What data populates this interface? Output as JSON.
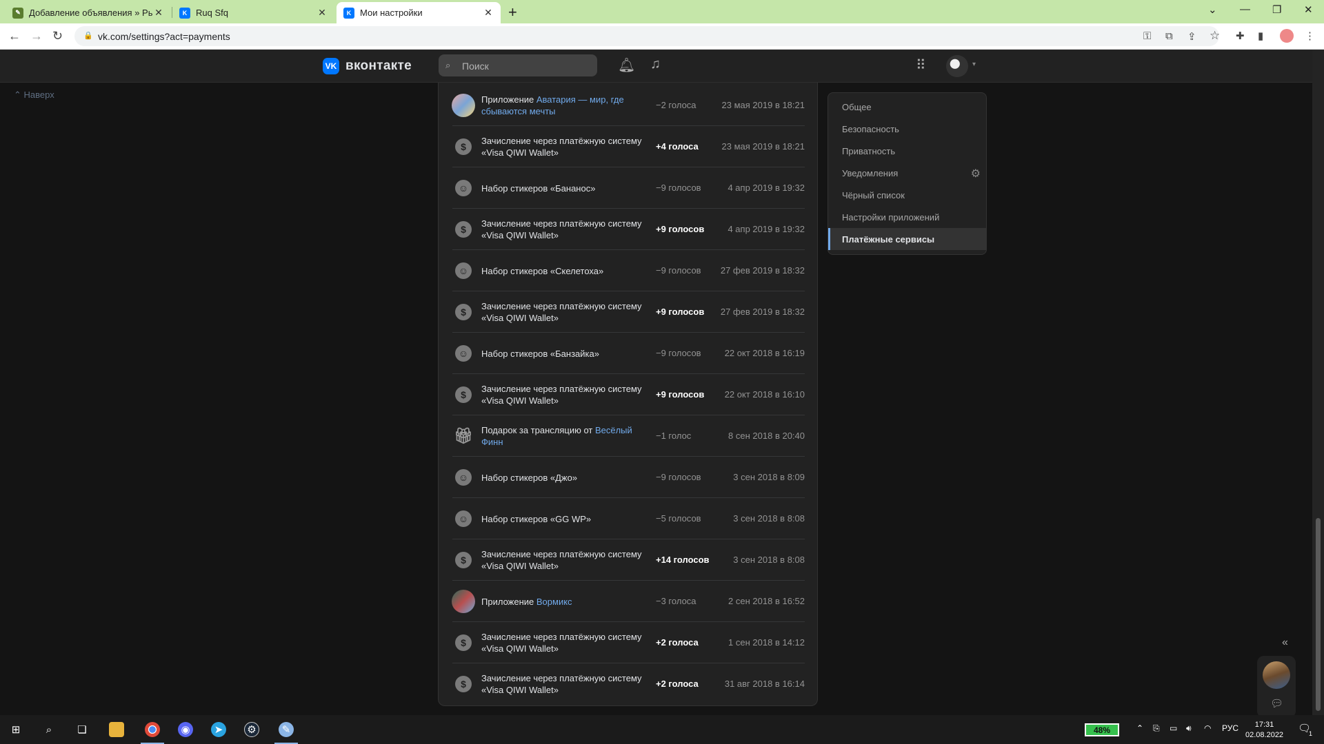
{
  "browser": {
    "tabs": [
      {
        "title": "Добавление объявления » Рын",
        "icon": "feather-icon",
        "color": "#5a7d2e",
        "active": false
      },
      {
        "title": "Ruq Sfq",
        "icon": "vk-icon",
        "color": "#0077ff",
        "active": false
      },
      {
        "title": "Мои настройки",
        "icon": "vk-icon",
        "color": "#0077ff",
        "active": true
      }
    ],
    "new_tab": "+",
    "address": "vk.com/settings?act=payments"
  },
  "vk": {
    "logo_text": "вконтакте",
    "logo_mark": "VK",
    "search_placeholder": "Поиск",
    "scroll_up_label": "Наверх",
    "accent": "#0077ff",
    "link_color": "#71aaeb"
  },
  "transactions": [
    {
      "kind": "app",
      "icon": "app-avatar-icon",
      "text": "Приложение ",
      "link": "Аватария — мир, где сбываются мечты",
      "amount": "−2 голоса",
      "positive": false,
      "date": "23 мая 2019 в 18:21"
    },
    {
      "kind": "pay",
      "icon": "dollar-icon",
      "text": "Зачисление через платёжную систему «Visa QIWI Wallet»",
      "link": "",
      "amount": "+4 голоса",
      "positive": true,
      "date": "23 мая 2019 в 18:21"
    },
    {
      "kind": "sticker",
      "icon": "smile-icon",
      "text": "Набор стикеров «Бананос»",
      "link": "",
      "amount": "−9 голосов",
      "positive": false,
      "date": "4 апр 2019 в 19:32"
    },
    {
      "kind": "pay",
      "icon": "dollar-icon",
      "text": "Зачисление через платёжную систему «Visa QIWI Wallet»",
      "link": "",
      "amount": "+9 голосов",
      "positive": true,
      "date": "4 апр 2019 в 19:32"
    },
    {
      "kind": "sticker",
      "icon": "smile-icon",
      "text": "Набор стикеров «Скелетоха»",
      "link": "",
      "amount": "−9 голосов",
      "positive": false,
      "date": "27 фев 2019 в 18:32"
    },
    {
      "kind": "pay",
      "icon": "dollar-icon",
      "text": "Зачисление через платёжную систему «Visa QIWI Wallet»",
      "link": "",
      "amount": "+9 голосов",
      "positive": true,
      "date": "27 фев 2019 в 18:32"
    },
    {
      "kind": "sticker",
      "icon": "smile-icon",
      "text": "Набор стикеров «Банзайка»",
      "link": "",
      "amount": "−9 голосов",
      "positive": false,
      "date": "22 окт 2018 в 16:19"
    },
    {
      "kind": "pay",
      "icon": "dollar-icon",
      "text": "Зачисление через платёжную систему «Visa QIWI Wallet»",
      "link": "",
      "amount": "+9 голосов",
      "positive": true,
      "date": "22 окт 2018 в 16:10"
    },
    {
      "kind": "gift",
      "icon": "gift-icon",
      "text": "Подарок за трансляцию от ",
      "link": "Весёлый Финн",
      "amount": "−1 голос",
      "positive": false,
      "date": "8 сен 2018 в 20:40"
    },
    {
      "kind": "sticker",
      "icon": "smile-icon",
      "text": "Набор стикеров «Джо»",
      "link": "",
      "amount": "−9 голосов",
      "positive": false,
      "date": "3 сен 2018 в 8:09"
    },
    {
      "kind": "sticker",
      "icon": "smile-icon",
      "text": "Набор стикеров «GG WP»",
      "link": "",
      "amount": "−5 голосов",
      "positive": false,
      "date": "3 сен 2018 в 8:08"
    },
    {
      "kind": "pay",
      "icon": "dollar-icon",
      "text": "Зачисление через платёжную систему «Visa QIWI Wallet»",
      "link": "",
      "amount": "+14 голосов",
      "positive": true,
      "date": "3 сен 2018 в 8:08"
    },
    {
      "kind": "app2",
      "icon": "app-wormix-icon",
      "text": "Приложение ",
      "link": "Вормикс",
      "amount": "−3 голоса",
      "positive": false,
      "date": "2 сен 2018 в 16:52"
    },
    {
      "kind": "pay",
      "icon": "dollar-icon",
      "text": "Зачисление через платёжную систему «Visa QIWI Wallet»",
      "link": "",
      "amount": "+2 голоса",
      "positive": true,
      "date": "1 сен 2018 в 14:12"
    },
    {
      "kind": "pay",
      "icon": "dollar-icon",
      "text": "Зачисление через платёжную систему «Visa QIWI Wallet»",
      "link": "",
      "amount": "+2 голоса",
      "positive": true,
      "date": "31 авг 2018 в 16:14"
    }
  ],
  "settings_menu": [
    {
      "label": "Общее",
      "active": false
    },
    {
      "label": "Безопасность",
      "active": false
    },
    {
      "label": "Приватность",
      "active": false
    },
    {
      "label": "Уведомления",
      "active": false,
      "gear": true
    },
    {
      "label": "Чёрный список",
      "active": false
    },
    {
      "label": "Настройки приложений",
      "active": false
    },
    {
      "label": "Платёжные сервисы",
      "active": true
    }
  ],
  "taskbar": {
    "battery": "48%",
    "language": "РУС",
    "time": "17:31",
    "date": "02.08.2022",
    "notification_count": "1"
  }
}
